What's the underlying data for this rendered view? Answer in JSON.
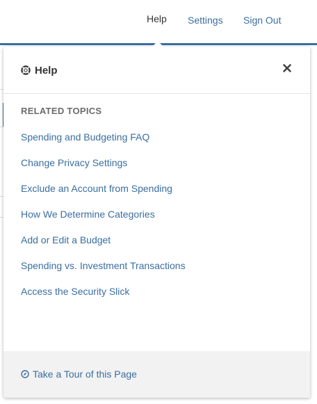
{
  "topnav": {
    "help_label": "Help",
    "settings_label": "Settings",
    "signout_label": "Sign Out"
  },
  "panel": {
    "title": "Help",
    "title_icon": "lifebuoy-icon",
    "close_icon": "close-icon",
    "section_heading": "RELATED TOPICS",
    "topics": [
      "Spending and Budgeting FAQ",
      "Change Privacy Settings",
      "Exclude an Account from Spending",
      "How We Determine Categories",
      "Add or Edit a Budget",
      "Spending vs. Investment Transactions",
      "Access the Security Slick"
    ],
    "footer": {
      "tour_label": "Take a Tour of this Page",
      "tour_icon": "compass-icon"
    }
  },
  "colors": {
    "link": "#3a6ea0",
    "accent_bar": "#3a6ea0",
    "text_dark": "#333333",
    "footer_bg": "#f2f2f2"
  }
}
